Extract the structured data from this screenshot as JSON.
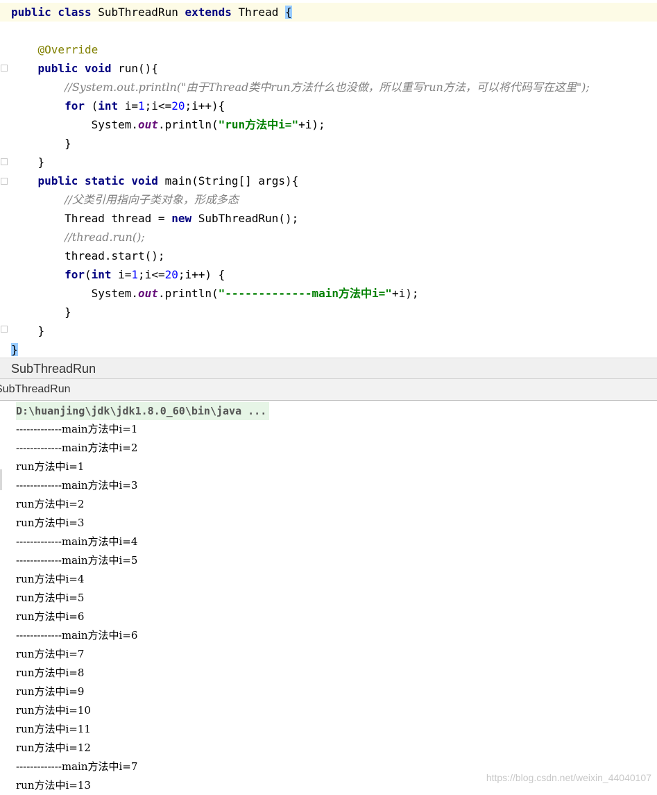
{
  "editor": {
    "lines": [
      "public class SubThreadRun extends Thread {",
      "",
      "    @Override",
      "    public void run(){",
      "        //System.out.println(\"由于Thread类中run方法什么也没做，所以重写run方法，可以将代码写在这里\");",
      "        for (int i=1;i<=20;i++){",
      "            System.out.println(\"run方法中i=\"+i);",
      "        }",
      "    }",
      "    public static void main(String[] args){",
      "        //父类引用指向子类对象，形成多态",
      "        Thread thread = new SubThreadRun();",
      "        //thread.run();",
      "        thread.start();",
      "        for(int i=1;i<=20;i++) {",
      "            System.out.println(\"-------------main方法中i=\"+i);",
      "        }",
      "    }",
      "}"
    ]
  },
  "tabs": {
    "editor_tab": "SubThreadRun",
    "run_tab": "SubThreadRun"
  },
  "console": {
    "command": "D:\\huanjing\\jdk\\jdk1.8.0_60\\bin\\java ...",
    "output": [
      "-------------main方法中i=1",
      "-------------main方法中i=2",
      "run方法中i=1",
      "-------------main方法中i=3",
      "run方法中i=2",
      "run方法中i=3",
      "-------------main方法中i=4",
      "-------------main方法中i=5",
      "run方法中i=4",
      "run方法中i=5",
      "run方法中i=6",
      "-------------main方法中i=6",
      "run方法中i=7",
      "run方法中i=8",
      "run方法中i=9",
      "run方法中i=10",
      "run方法中i=11",
      "run方法中i=12",
      "-------------main方法中i=7",
      "run方法中i=13"
    ]
  },
  "watermark": "https://blog.csdn.net/weixin_44040107"
}
